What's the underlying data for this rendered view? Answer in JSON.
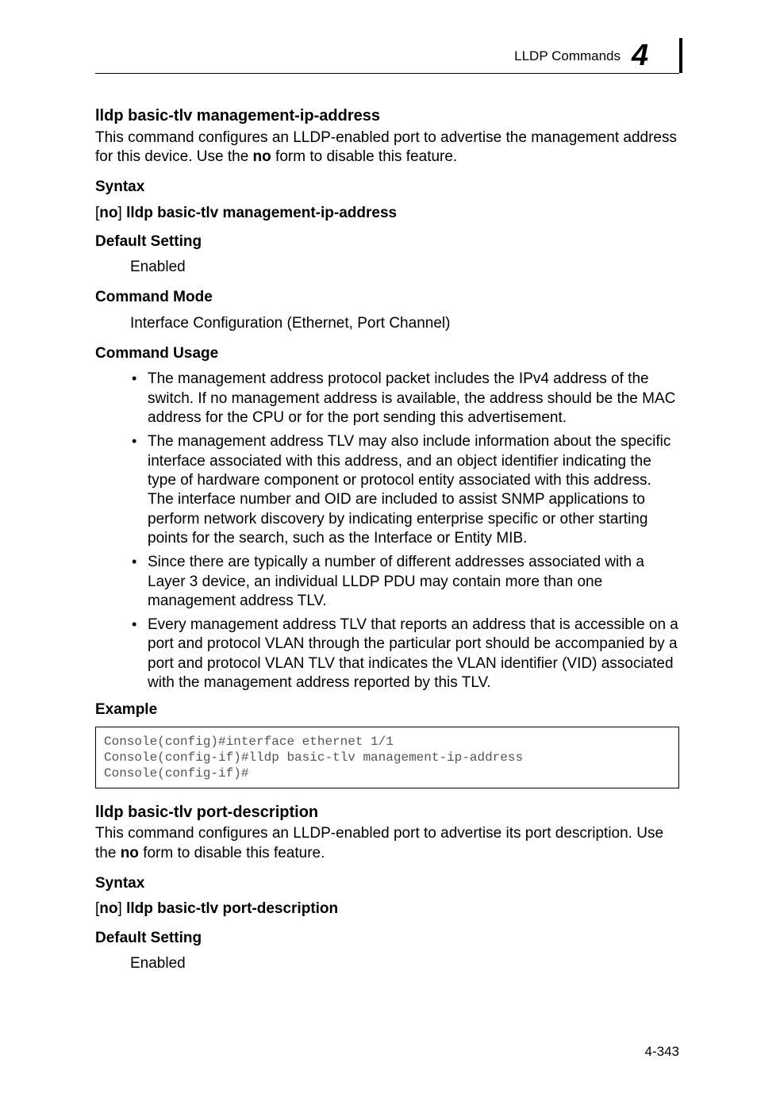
{
  "header": {
    "section": "LLDP Commands",
    "chapter": "4"
  },
  "cmd1": {
    "title": "lldp basic-tlv management-ip-address",
    "desc_pre": "This command configures an LLDP-enabled port to advertise the management address for this device. Use the ",
    "desc_bold": "no",
    "desc_post": " form to disable this feature.",
    "syntax_label": "Syntax",
    "syntax_open": "[",
    "syntax_no": "no",
    "syntax_close": "] ",
    "syntax_cmd": "lldp basic-tlv management-ip-address",
    "default_label": "Default Setting",
    "default_value": "Enabled",
    "mode_label": "Command Mode",
    "mode_value": "Interface Configuration (Ethernet, Port Channel)",
    "usage_label": "Command Usage",
    "bullets": [
      "The management address protocol packet includes the IPv4 address of the switch. If no management address is available, the address should be the MAC address for the CPU or for the port sending this advertisement.",
      "The management address TLV may also include information about the specific interface associated with this address, and an object identifier indicating the type of hardware component or protocol entity associated with this address. The interface number and OID are included to assist SNMP applications to perform network discovery by indicating enterprise specific or other starting points for the search, such as the Interface or Entity MIB.",
      "Since there are typically a number of different addresses associated with a Layer 3 device, an individual LLDP PDU may contain more than one management address TLV.",
      "Every management address TLV that reports an address that is accessible on a port and protocol VLAN through the particular port should be accompanied by a port and protocol VLAN TLV that indicates the VLAN identifier (VID) associated with the management address reported by this TLV."
    ],
    "example_label": "Example",
    "example_code": "Console(config)#interface ethernet 1/1\nConsole(config-if)#lldp basic-tlv management-ip-address\nConsole(config-if)#"
  },
  "cmd2": {
    "title": "lldp basic-tlv port-description",
    "desc_pre": "This command configures an LLDP-enabled port to advertise its port description. Use the ",
    "desc_bold": "no",
    "desc_post": " form to disable this feature.",
    "syntax_label": "Syntax",
    "syntax_open": "[",
    "syntax_no": "no",
    "syntax_close": "] ",
    "syntax_cmd": "lldp basic-tlv port-description",
    "default_label": "Default Setting",
    "default_value": "Enabled"
  },
  "footer": {
    "page": "4-343"
  }
}
